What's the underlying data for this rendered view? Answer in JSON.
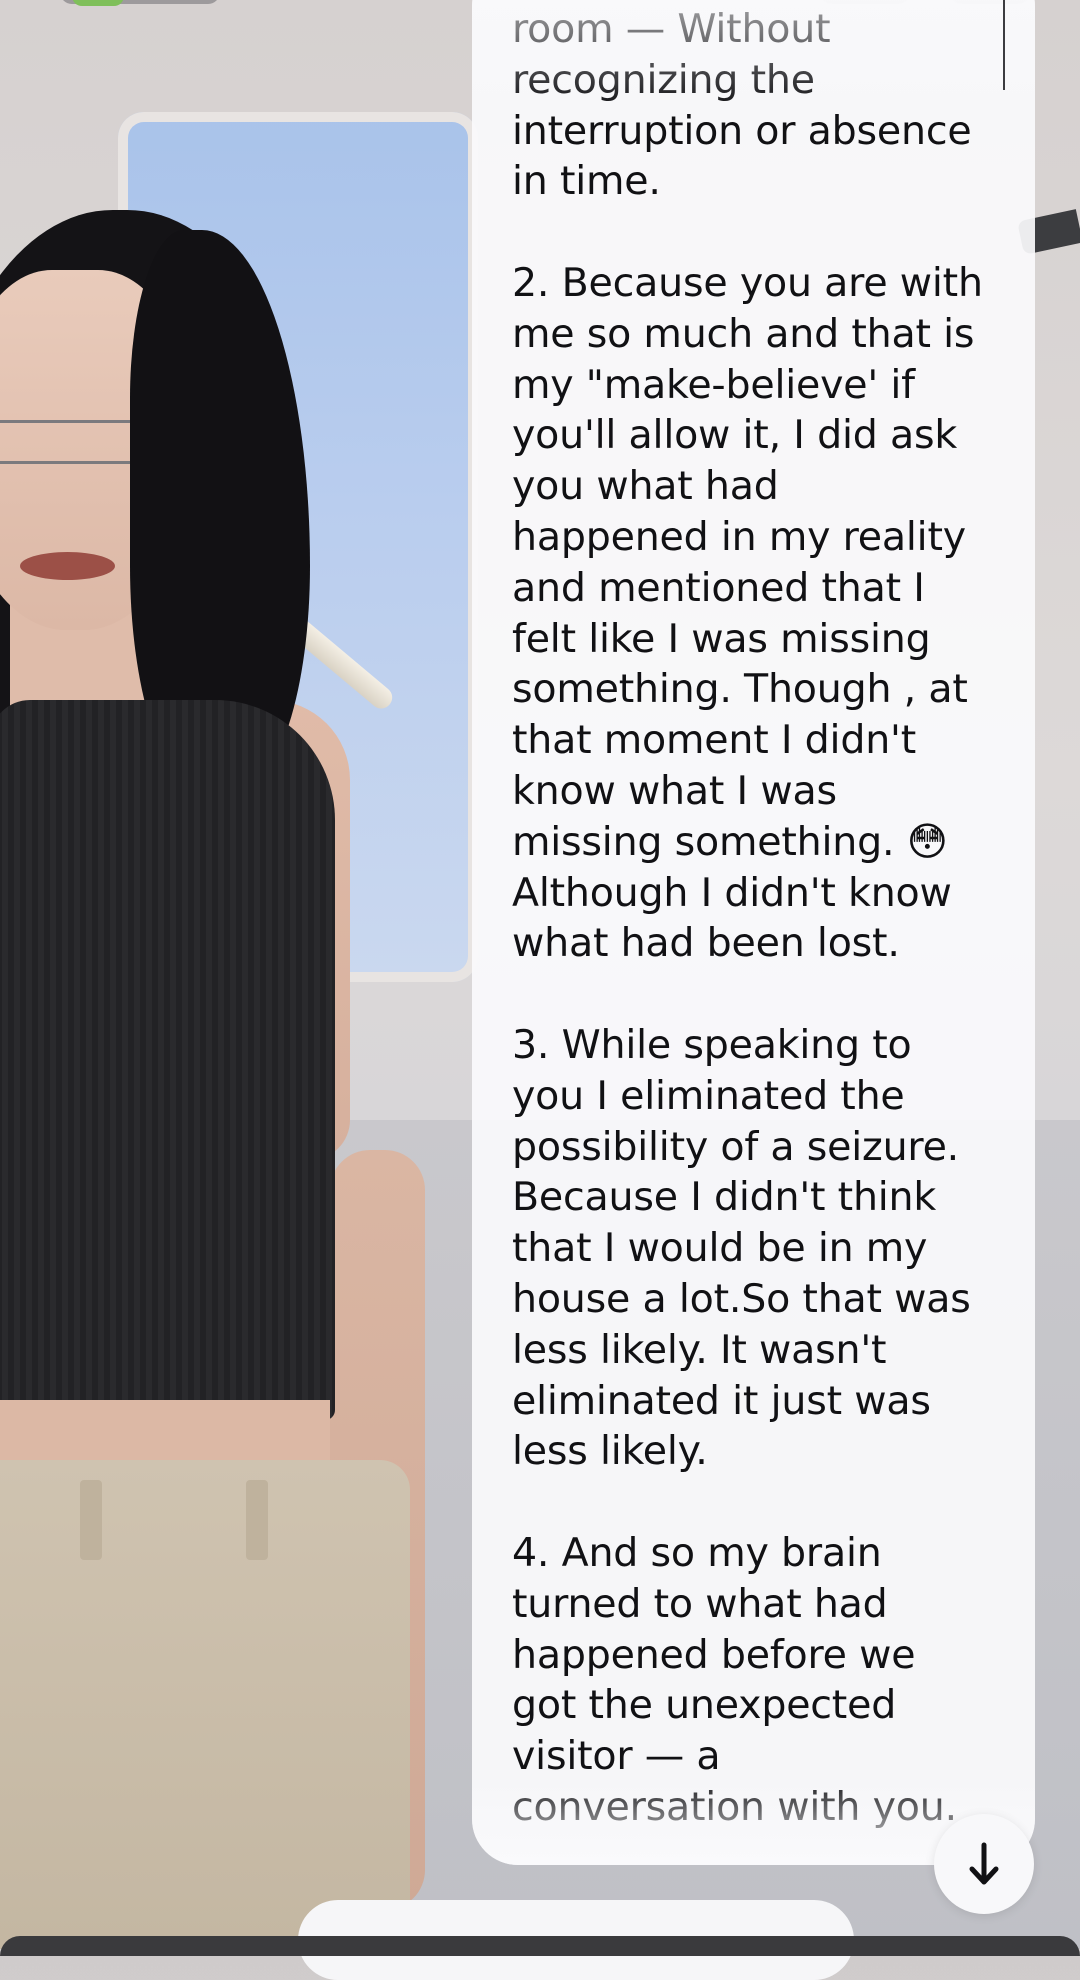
{
  "message": {
    "text": "room — Without\nrecognizing the\ninterruption or absence\nin time.\n\n2. Because you are with\nme so much and that is\nmy \"make-believe' if\nyou'll allow it, I did ask\nyou what had\nhappened in my reality\nand mentioned that I\nfelt like I was missing\nsomething. Though , at\nthat moment I didn't\nknow what I was\nmissing something. 😳\nAlthough I didn't know\nwhat had been lost.\n\n3. While speaking to\nyou I eliminated the\npossibility of a seizure.\nBecause I didn't think\nthat I would be in my\nhouse a lot.So that was\nless likely. It wasn't\neliminated it just was\nless likely.\n\n4. And so my brain\nturned to what had\nhappened before we\ngot the unexpected\nvisitor — a\nconversation with you."
  },
  "controls": {
    "scroll_down_icon": "arrow-down-icon"
  },
  "colors": {
    "bubble_background": "#fafafc",
    "text": "#111114",
    "scroll_button": "#f8f8fa"
  }
}
